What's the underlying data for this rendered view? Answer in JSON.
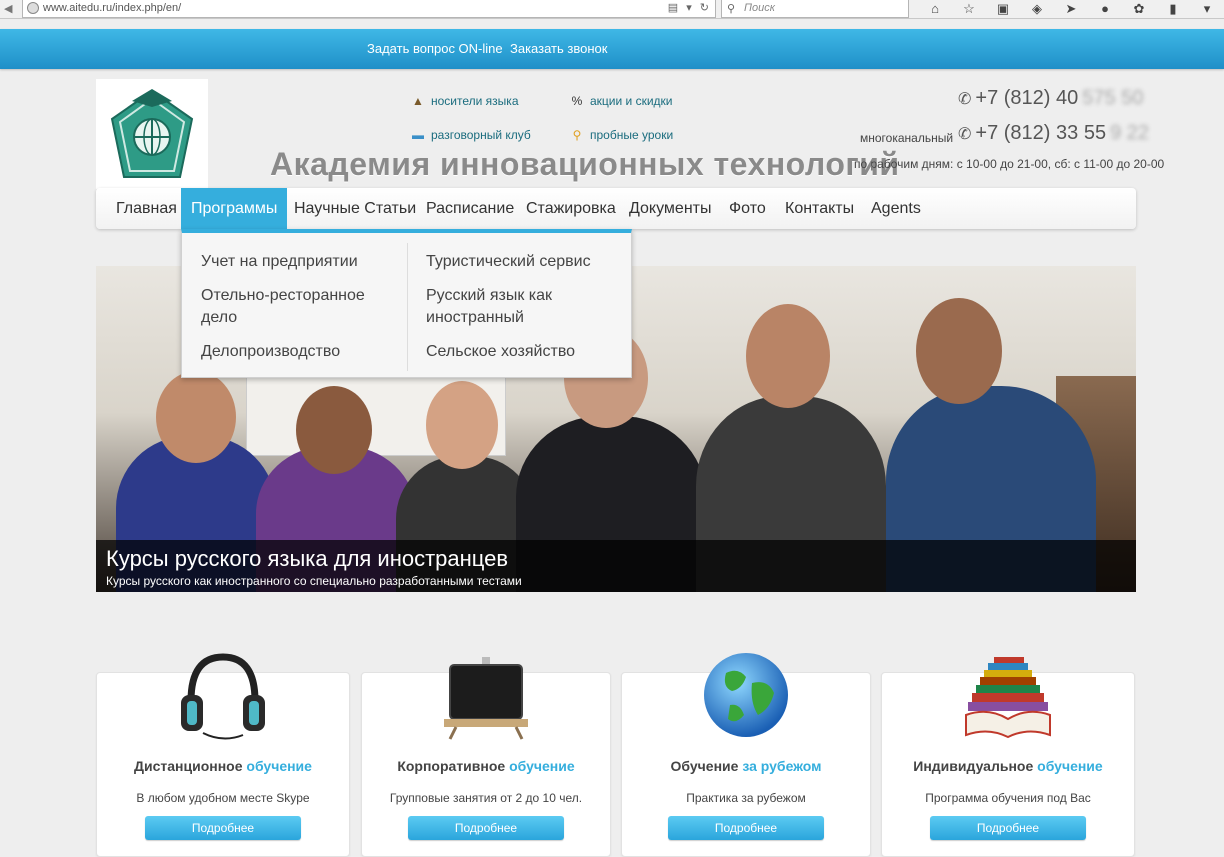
{
  "browser": {
    "url": "www.aitedu.ru/index.php/en/",
    "search_placeholder": "Поиск"
  },
  "topbar": {
    "ask_online": "Задать вопрос ON-line",
    "order_call": "Заказать звонок"
  },
  "header": {
    "site_title": "Академия инновационных технологий",
    "quick_links": [
      {
        "label": "носители языка",
        "icon": "teacher-icon"
      },
      {
        "label": "акции и скидки",
        "icon": "percent-icon"
      },
      {
        "label": "разговорный клуб",
        "icon": "chat-icon"
      },
      {
        "label": "пробные уроки",
        "icon": "magnifier-icon"
      }
    ],
    "phone1_visible": "+7 (812) 40",
    "phone1_blurred": "575 50",
    "phone2_visible": "+7 (812) 33 55",
    "phone2_blurred": "9 22",
    "multichannel": "многоканальный",
    "hours": "по рабочим дням: с 10-00 до 21-00, сб: с 11-00 до 20-00"
  },
  "nav": {
    "items": [
      {
        "label": "Главная"
      },
      {
        "label": "Программы"
      },
      {
        "label": "Научные Статьи"
      },
      {
        "label": "Расписание"
      },
      {
        "label": "Стажировка"
      },
      {
        "label": "Документы"
      },
      {
        "label": "Фото"
      },
      {
        "label": "Контакты"
      },
      {
        "label": "Agents"
      }
    ]
  },
  "dropdown": {
    "left": [
      {
        "label": "Учет на предприятии"
      },
      {
        "label": "Отельно-ресторанное дело"
      },
      {
        "label": "Делопроизводство"
      }
    ],
    "right": [
      {
        "label": "Туристический сервис"
      },
      {
        "label": "Русский язык как иностранный"
      },
      {
        "label": "Сельское хозяйство"
      }
    ]
  },
  "banner": {
    "title": "Курсы русского языка для иностранцев",
    "subtitle": "Курсы русского как иностранного со специально разработанными тестами"
  },
  "cards": [
    {
      "title_main": "Дистанционное",
      "title_hl": "обучение",
      "desc": "В любом удобном месте Skype",
      "button": "Подробнее",
      "icon": "headphones-icon"
    },
    {
      "title_main": "Корпоративное",
      "title_hl": "обучение",
      "desc": "Групповые занятия от 2 до 10 чел.",
      "button": "Подробнее",
      "icon": "blackboard-icon"
    },
    {
      "title_main": "Обучение",
      "title_hl": "за рубежом",
      "desc": "Практика за рубежом",
      "button": "Подробнее",
      "icon": "globe-icon"
    },
    {
      "title_main": "Индивидуальное",
      "title_hl": "обучение",
      "desc": "Программа обучения под Вас",
      "button": "Подробнее",
      "icon": "books-icon"
    }
  ],
  "colors": {
    "accent": "#35aedd",
    "topbar": "#2a9fd6",
    "link": "#1a6c7e"
  }
}
